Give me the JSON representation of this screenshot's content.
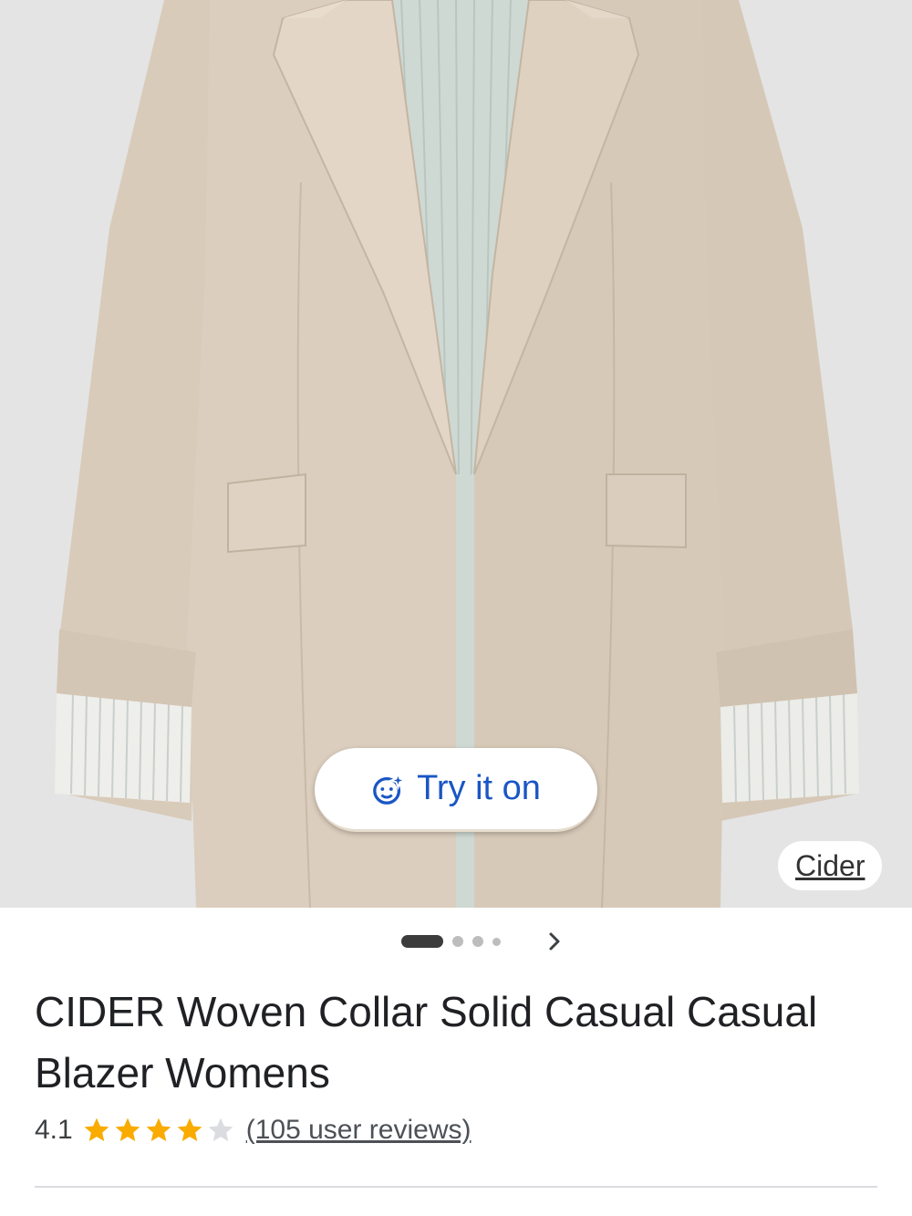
{
  "product_image": {
    "alt": "",
    "try_on_button": {
      "label": "Try it on",
      "icon": "try-on-sparkle-face-icon"
    },
    "source_chip": {
      "label": "Cider"
    }
  },
  "carousel": {
    "count": 4,
    "active_index": 0,
    "next_icon": "chevron-right-icon"
  },
  "product": {
    "title": "CIDER Woven Collar Solid Casual Casual Blazer Womens",
    "rating_value": "4.1",
    "rating_stars": 4.1,
    "rating_max": 5,
    "reviews_label": "(105 user reviews)"
  },
  "colors": {
    "accent_blue": "#1a56c4",
    "star_gold": "#f9ab00",
    "star_empty": "#dadce0",
    "jacket": "#d8cab9",
    "lining": "#cfd8d2"
  }
}
